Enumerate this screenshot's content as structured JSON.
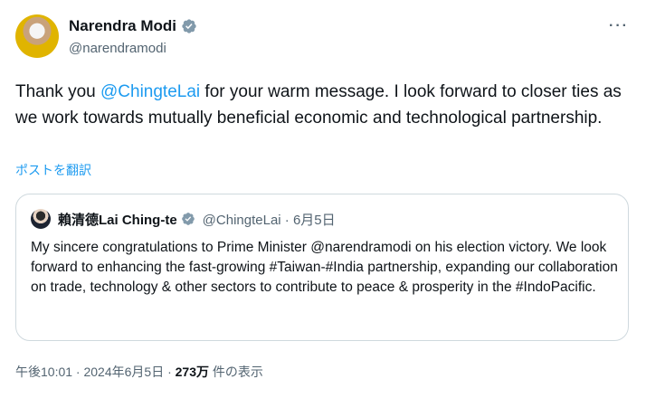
{
  "post": {
    "author_name": "Narendra Modi",
    "author_handle": "@narendramodi",
    "more_label": "···",
    "text_prefix": "Thank you ",
    "text_mention": "@ChingteLai",
    "text_suffix": " for your warm message. I look forward to closer ties as we work towards mutually beneficial economic and technological partnership.",
    "translate_label": "ポストを翻訳",
    "timestamp": "午後10:01 · 2024年6月5日 · ",
    "views_count": "273万",
    "views_label": " 件の表示"
  },
  "quote": {
    "author_name": "賴清德Lai Ching-te",
    "author_handle": "@ChingteLai · 6月5日",
    "text": "My sincere congratulations to Prime Minister @narendramodi on his election victory. We look forward to enhancing the fast-growing #Taiwan-#India partnership, expanding our collaboration on trade, technology & other sectors to contribute to peace & prosperity in the #IndoPacific."
  },
  "colors": {
    "accent": "#1d9bf0",
    "muted": "#536471",
    "text": "#0f1419",
    "border": "#cfd9de",
    "verified_gray": "#829aab"
  }
}
